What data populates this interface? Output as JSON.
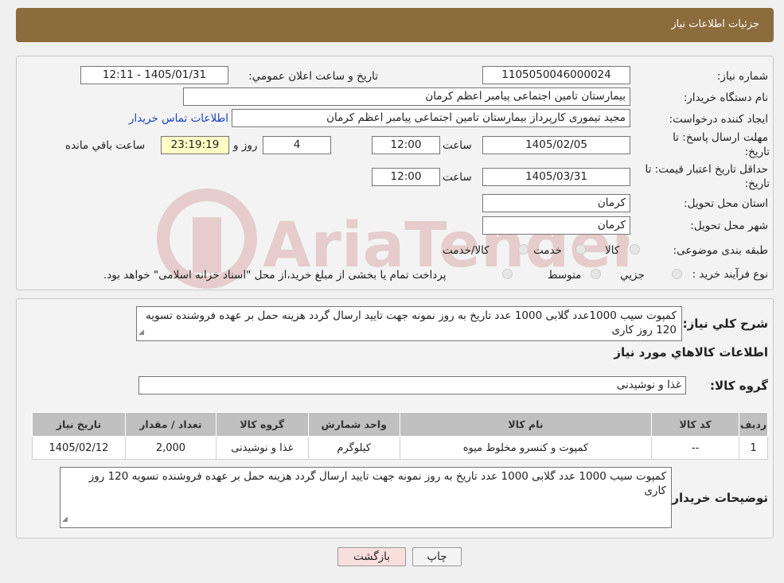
{
  "header": {
    "title": "جزئیات اطلاعات نیاز"
  },
  "form": {
    "need_number_label": "شماره نیاز:",
    "need_number": "1105050046000024",
    "announce_label": "تاریخ و ساعت اعلان عمومي:",
    "announce_value": "1405/01/31 - 12:11",
    "buyer_org_label": "نام دستگاه خريدار:",
    "buyer_org": "بیمارستان تامین اجتماعی پیامبر اعظم کرمان",
    "creator_label": "ايجاد کننده درخواست:",
    "creator": "مجید تیموری کارپرداز بیمارستان تامین اجتماعی پیامبر اعظم کرمان",
    "contact_link": "اطلاعات تماس خريدار",
    "deadline_label_1": "مهلت ارسال پاسخ: تا",
    "deadline_label_2": "تاريخ:",
    "deadline_date": "1405/02/05",
    "time_label": "ساعت",
    "deadline_time": "12:00",
    "days_value": "4",
    "days_label": "روز و",
    "remaining_time": "23:19:19",
    "remaining_label": "ساعت باقي مانده",
    "validity_label_1": "حداقل تاريخ اعتبار قيمت: تا",
    "validity_label_2": "تاريخ:",
    "validity_date": "1405/03/31",
    "validity_time_label": "ساعت",
    "validity_time": "12:00",
    "province_label": "استان محل تحويل:",
    "province": "کرمان",
    "city_label": "شهر محل تحويل:",
    "city": "کرمان",
    "category_label": "طبقه بندی موضوعی:",
    "category_options": [
      "کالا",
      "خدمت",
      "کالا/خدمت"
    ],
    "process_label": "نوع فرآيند خريد :",
    "process_options": [
      "جزيي",
      "متوسط"
    ],
    "process_note": "پرداخت تمام يا بخشی از مبلغ خريد،از محل \"اسناد خزانه اسلامی\" خواهد بود."
  },
  "details": {
    "summary_label": "شرح کلي نياز:",
    "summary_text": "کمپوت سیب 1000عدد گلابی 1000 عدد تاریخ به روز نمونه جهت تایید ارسال گردد هزینه حمل بر عهده فروشنده تسویه 120 روز کاری",
    "goods_info_title": "اطلاعات کالاهاي مورد نياز",
    "goods_group_label": "گروه کالا:",
    "goods_group": "غذا و نوشیدنی",
    "table_headers": [
      "رديف",
      "کد کالا",
      "نام کالا",
      "واحد شمارش",
      "گروه کالا",
      "تعداد / مقدار",
      "تاريخ نياز"
    ],
    "table_rows": [
      [
        "1",
        "--",
        "کمپوت و کنسرو مخلوط میوه",
        "کیلوگرم",
        "غذا و نوشیدنی",
        "2,000",
        "1405/02/12"
      ]
    ],
    "buyer_notes_label": "توضيحات خريدار:",
    "buyer_notes": "کمپوت سیب 1000 عدد گلابی 1000 عدد تاریخ به روز نمونه جهت تایید ارسال گردد هزینه حمل بر عهده فروشنده تسویه 120 روز کاری"
  },
  "buttons": {
    "print": "چاپ",
    "back": "بازگشت"
  },
  "watermark": {
    "text": "AriaTender.neT"
  },
  "colors": {
    "header": "#8c6b3c",
    "link": "#1a44c4",
    "remaining_bg": "#ffffc6",
    "back_button_bg": "#f9dede"
  }
}
